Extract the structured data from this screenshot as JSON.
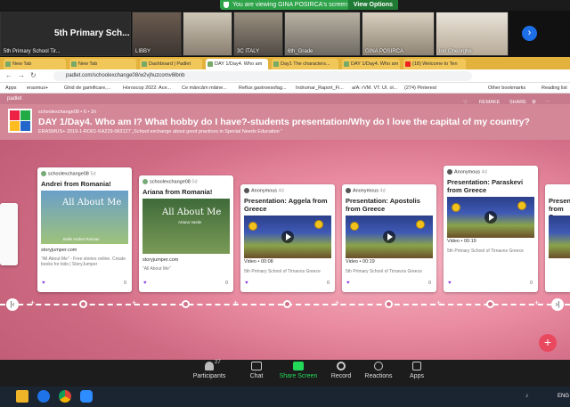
{
  "zoom": {
    "banner_text": "You are viewing GINA POSIRCA's screen",
    "view_options": "View Options",
    "tiles": [
      {
        "name": "5th Primary School Tir...",
        "big": "5th Primary Sch..."
      },
      {
        "name": "LIBBY"
      },
      {
        "name": "3C ITALY"
      },
      {
        "name": "6th_Grade"
      },
      {
        "name": "GINA POSIRCA"
      },
      {
        "name": "Ion Gheorghe"
      }
    ],
    "toolbar": {
      "participants_label": "Participants",
      "participants_count": "27",
      "chat_label": "Chat",
      "share_label": "Share Screen",
      "record_label": "Record",
      "reactions_label": "Reactions",
      "apps_label": "Apps"
    }
  },
  "browser": {
    "tabs": [
      "New Tab",
      "New Tab",
      "Dashboard | Padlet",
      "DAY 1/Day4. Who am",
      "Day1 The characters...",
      "DAY 1/Day4. Who am",
      "(18) Welcome to Ten"
    ],
    "address": "padlet.com/schoolexchange08/w2vjhuzcomv6lbnb",
    "bookmarks": [
      "Apps",
      "erasmus+",
      "Ghid de gamificare,...",
      "Horoscop 2022: Ace...",
      "Ce mâncăm mâine...",
      "Reflux gastroesofag...",
      "Indrumar_Raport_Fi...",
      "a/A: rVM. VT. UI. ol...",
      "(274) Pinterest",
      "Other bookmarks",
      "Reading list"
    ]
  },
  "padlet": {
    "brand": "padlet",
    "author": "schoolexchange08 • 6 • 1h",
    "title": "DAY 1/Day4. Who am I? What hobby do I have?-students presentation/Why do I love the capital of my country?",
    "subtitle": "ERASMUS+ 2019-1-RO01-KA229-063127 „School exchange about good practices in Special Needs Education \"",
    "actions": {
      "remake": "REMAKE",
      "share": "SHARE"
    },
    "cards": [
      {
        "author": "schoolexchange08",
        "age": "5d",
        "title": "Andrei from Romania!",
        "caption": "\"All About Me\" - Free stories online. Create books for kids | StoryJumper",
        "link": "storyjumper.com",
        "comments": "0",
        "thumb_text": "All About Me",
        "thumb_sub": "Bolle Andrei Razvan"
      },
      {
        "author": "schoolexchange08",
        "age": "5d",
        "title": "Ariana from Romania!",
        "caption": "\"All About Me\"",
        "link": "storyjumper.com",
        "comments": "0",
        "thumb_text": "All About Me",
        "thumb_sub": "Ariana Vasile"
      },
      {
        "author": "Anonymous",
        "age": "4d",
        "title": "Presentation: Aggela from Greece",
        "video_time": "Video • 00:08",
        "school": "5th Primary School of Tirnavos Greece",
        "comments": "0"
      },
      {
        "author": "Anonymous",
        "age": "4d",
        "title": "Presentation: Apostolis from Greece",
        "video_time": "Video • 00:19",
        "school": "5th Primary School of Tirnavos Greece",
        "comments": "0"
      },
      {
        "author": "Anonymous",
        "age": "4d",
        "title": "Presentation: Paraskevi from Greece",
        "video_time": "Video • 00:19",
        "school": "5th Primary School of Tirnavos Greece",
        "comments": "0"
      },
      {
        "title": "Presente from Gre..."
      }
    ]
  },
  "taskbar": {
    "lang": "ENG"
  },
  "colors": {
    "zoom_green": "#2ea34a",
    "tab_yellow": "#e3b23c",
    "padlet_pink": "#d48797",
    "heart": "#8a3ee0",
    "fab": "#e9495f"
  }
}
